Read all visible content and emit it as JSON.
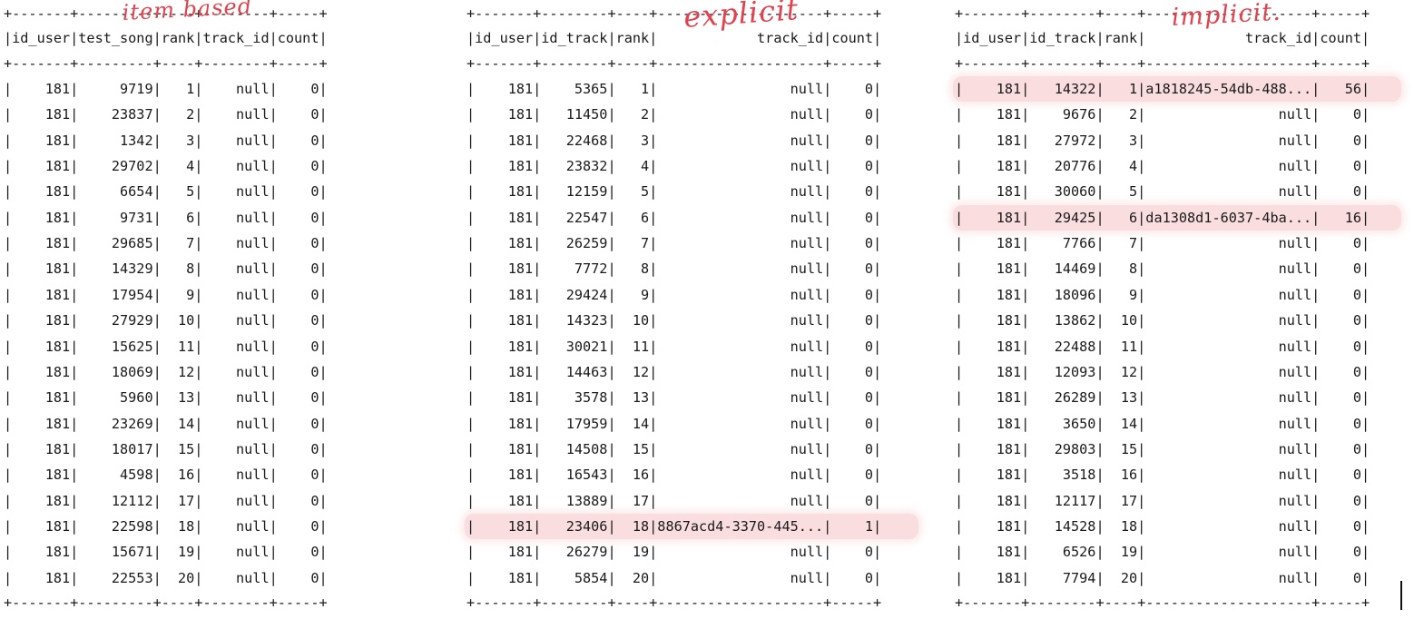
{
  "annotations": {
    "item_based": "item based",
    "explicit": "explicit",
    "implicit": "implicit."
  },
  "tables": [
    {
      "border": "+-------+---------+----+--------+-----+",
      "header": "|id_user|test_song|rank|track_id|count|",
      "rows": [
        "|    181|     9719|   1|    null|    0|",
        "|    181|    23837|   2|    null|    0|",
        "|    181|     1342|   3|    null|    0|",
        "|    181|    29702|   4|    null|    0|",
        "|    181|     6654|   5|    null|    0|",
        "|    181|     9731|   6|    null|    0|",
        "|    181|    29685|   7|    null|    0|",
        "|    181|    14329|   8|    null|    0|",
        "|    181|    17954|   9|    null|    0|",
        "|    181|    27929|  10|    null|    0|",
        "|    181|    15625|  11|    null|    0|",
        "|    181|    18069|  12|    null|    0|",
        "|    181|     5960|  13|    null|    0|",
        "|    181|    23269|  14|    null|    0|",
        "|    181|    18017|  15|    null|    0|",
        "|    181|     4598|  16|    null|    0|",
        "|    181|    12112|  17|    null|    0|",
        "|    181|    22598|  18|    null|    0|",
        "|    181|    15671|  19|    null|    0|",
        "|    181|    22553|  20|    null|    0|"
      ],
      "highlighted_rows": []
    },
    {
      "border": "+-------+--------+----+--------------------+-----+",
      "header": "|id_user|id_track|rank|            track_id|count|",
      "rows": [
        "|    181|    5365|   1|                null|    0|",
        "|    181|   11450|   2|                null|    0|",
        "|    181|   22468|   3|                null|    0|",
        "|    181|   23832|   4|                null|    0|",
        "|    181|   12159|   5|                null|    0|",
        "|    181|   22547|   6|                null|    0|",
        "|    181|   26259|   7|                null|    0|",
        "|    181|    7772|   8|                null|    0|",
        "|    181|   29424|   9|                null|    0|",
        "|    181|   14323|  10|                null|    0|",
        "|    181|   30021|  11|                null|    0|",
        "|    181|   14463|  12|                null|    0|",
        "|    181|    3578|  13|                null|    0|",
        "|    181|   17959|  14|                null|    0|",
        "|    181|   14508|  15|                null|    0|",
        "|    181|   16543|  16|                null|    0|",
        "|    181|   13889|  17|                null|    0|",
        "|    181|   23406|  18|8867acd4-3370-445...|    1|",
        "|    181|   26279|  19|                null|    0|",
        "|    181|    5854|  20|                null|    0|"
      ],
      "highlighted_rows": [
        17
      ]
    },
    {
      "border": "+-------+--------+----+--------------------+-----+",
      "header": "|id_user|id_track|rank|            track_id|count|",
      "rows": [
        "|    181|   14322|   1|a1818245-54db-488...|   56|",
        "|    181|    9676|   2|                null|    0|",
        "|    181|   27972|   3|                null|    0|",
        "|    181|   20776|   4|                null|    0|",
        "|    181|   30060|   5|                null|    0|",
        "|    181|   29425|   6|da1308d1-6037-4ba...|   16|",
        "|    181|    7766|   7|                null|    0|",
        "|    181|   14469|   8|                null|    0|",
        "|    181|   18096|   9|                null|    0|",
        "|    181|   13862|  10|                null|    0|",
        "|    181|   22488|  11|                null|    0|",
        "|    181|   12093|  12|                null|    0|",
        "|    181|   26289|  13|                null|    0|",
        "|    181|    3650|  14|                null|    0|",
        "|    181|   29803|  15|                null|    0|",
        "|    181|    3518|  16|                null|    0|",
        "|    181|   12117|  17|                null|    0|",
        "|    181|   14528|  18|                null|    0|",
        "|    181|    6526|  19|                null|    0|",
        "|    181|    7794|  20|                null|    0|"
      ],
      "highlighted_rows": [
        0,
        5
      ]
    }
  ]
}
